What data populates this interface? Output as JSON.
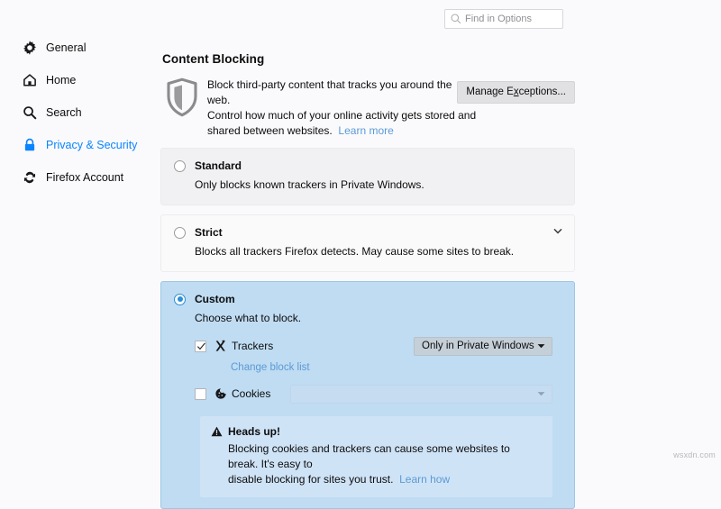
{
  "search": {
    "placeholder": "Find in Options",
    "value": "",
    "icon": "search-icon"
  },
  "sidebar": {
    "items": [
      {
        "label": "General",
        "icon": "gear-icon",
        "active": false
      },
      {
        "label": "Home",
        "icon": "home-icon",
        "active": false
      },
      {
        "label": "Search",
        "icon": "search-icon",
        "active": false
      },
      {
        "label": "Privacy & Security",
        "icon": "lock-icon",
        "active": true
      },
      {
        "label": "Firefox Account",
        "icon": "sync-icon",
        "active": false
      }
    ],
    "active_color": "#0a84ff"
  },
  "main": {
    "title": "Content Blocking",
    "shield_icon": "shield-icon",
    "description_line1": "Block third-party content that tracks you around the web.",
    "description_line2": "Control how much of your online activity gets stored and",
    "description_line3": "shared between websites.",
    "learn_more": "Learn more",
    "manage_exceptions": {
      "prefix": "Manage E",
      "accesskey": "x",
      "suffix": "ceptions..."
    },
    "options": [
      {
        "id": "standard",
        "label": "Standard",
        "description": "Only blocks known trackers in Private Windows.",
        "selected": false,
        "expandable": false
      },
      {
        "id": "strict",
        "label": "Strict",
        "description": "Blocks all trackers Firefox detects. May cause some sites to break.",
        "selected": false,
        "expandable": true
      },
      {
        "id": "custom",
        "label": "Custom",
        "description": "Choose what to block.",
        "selected": true,
        "expandable": false
      }
    ],
    "custom": {
      "trackers": {
        "label": "Trackers",
        "icon": "tracker-icon",
        "checked": true,
        "select_value": "Only in Private Windows",
        "select_enabled": true
      },
      "change_block_list": "Change block list",
      "cookies": {
        "label": "Cookies",
        "icon": "cookie-icon",
        "checked": false,
        "select_value": "",
        "select_enabled": false
      },
      "headsup": {
        "icon": "warning-icon",
        "title": "Heads up!",
        "body_line1": "Blocking cookies and trackers can cause some websites to break. It's easy to",
        "body_line2": "disable blocking for sites you trust.",
        "learn_how": "Learn how"
      }
    }
  },
  "colors": {
    "accent_blue": "#0a84ff",
    "link_blue": "#5b9ad6",
    "custom_panel_bg": "#bfdcf2",
    "headsup_bg": "#cfe3f6",
    "standard_panel_bg": "#f1f1f3"
  },
  "watermark": "wsxdn.com"
}
